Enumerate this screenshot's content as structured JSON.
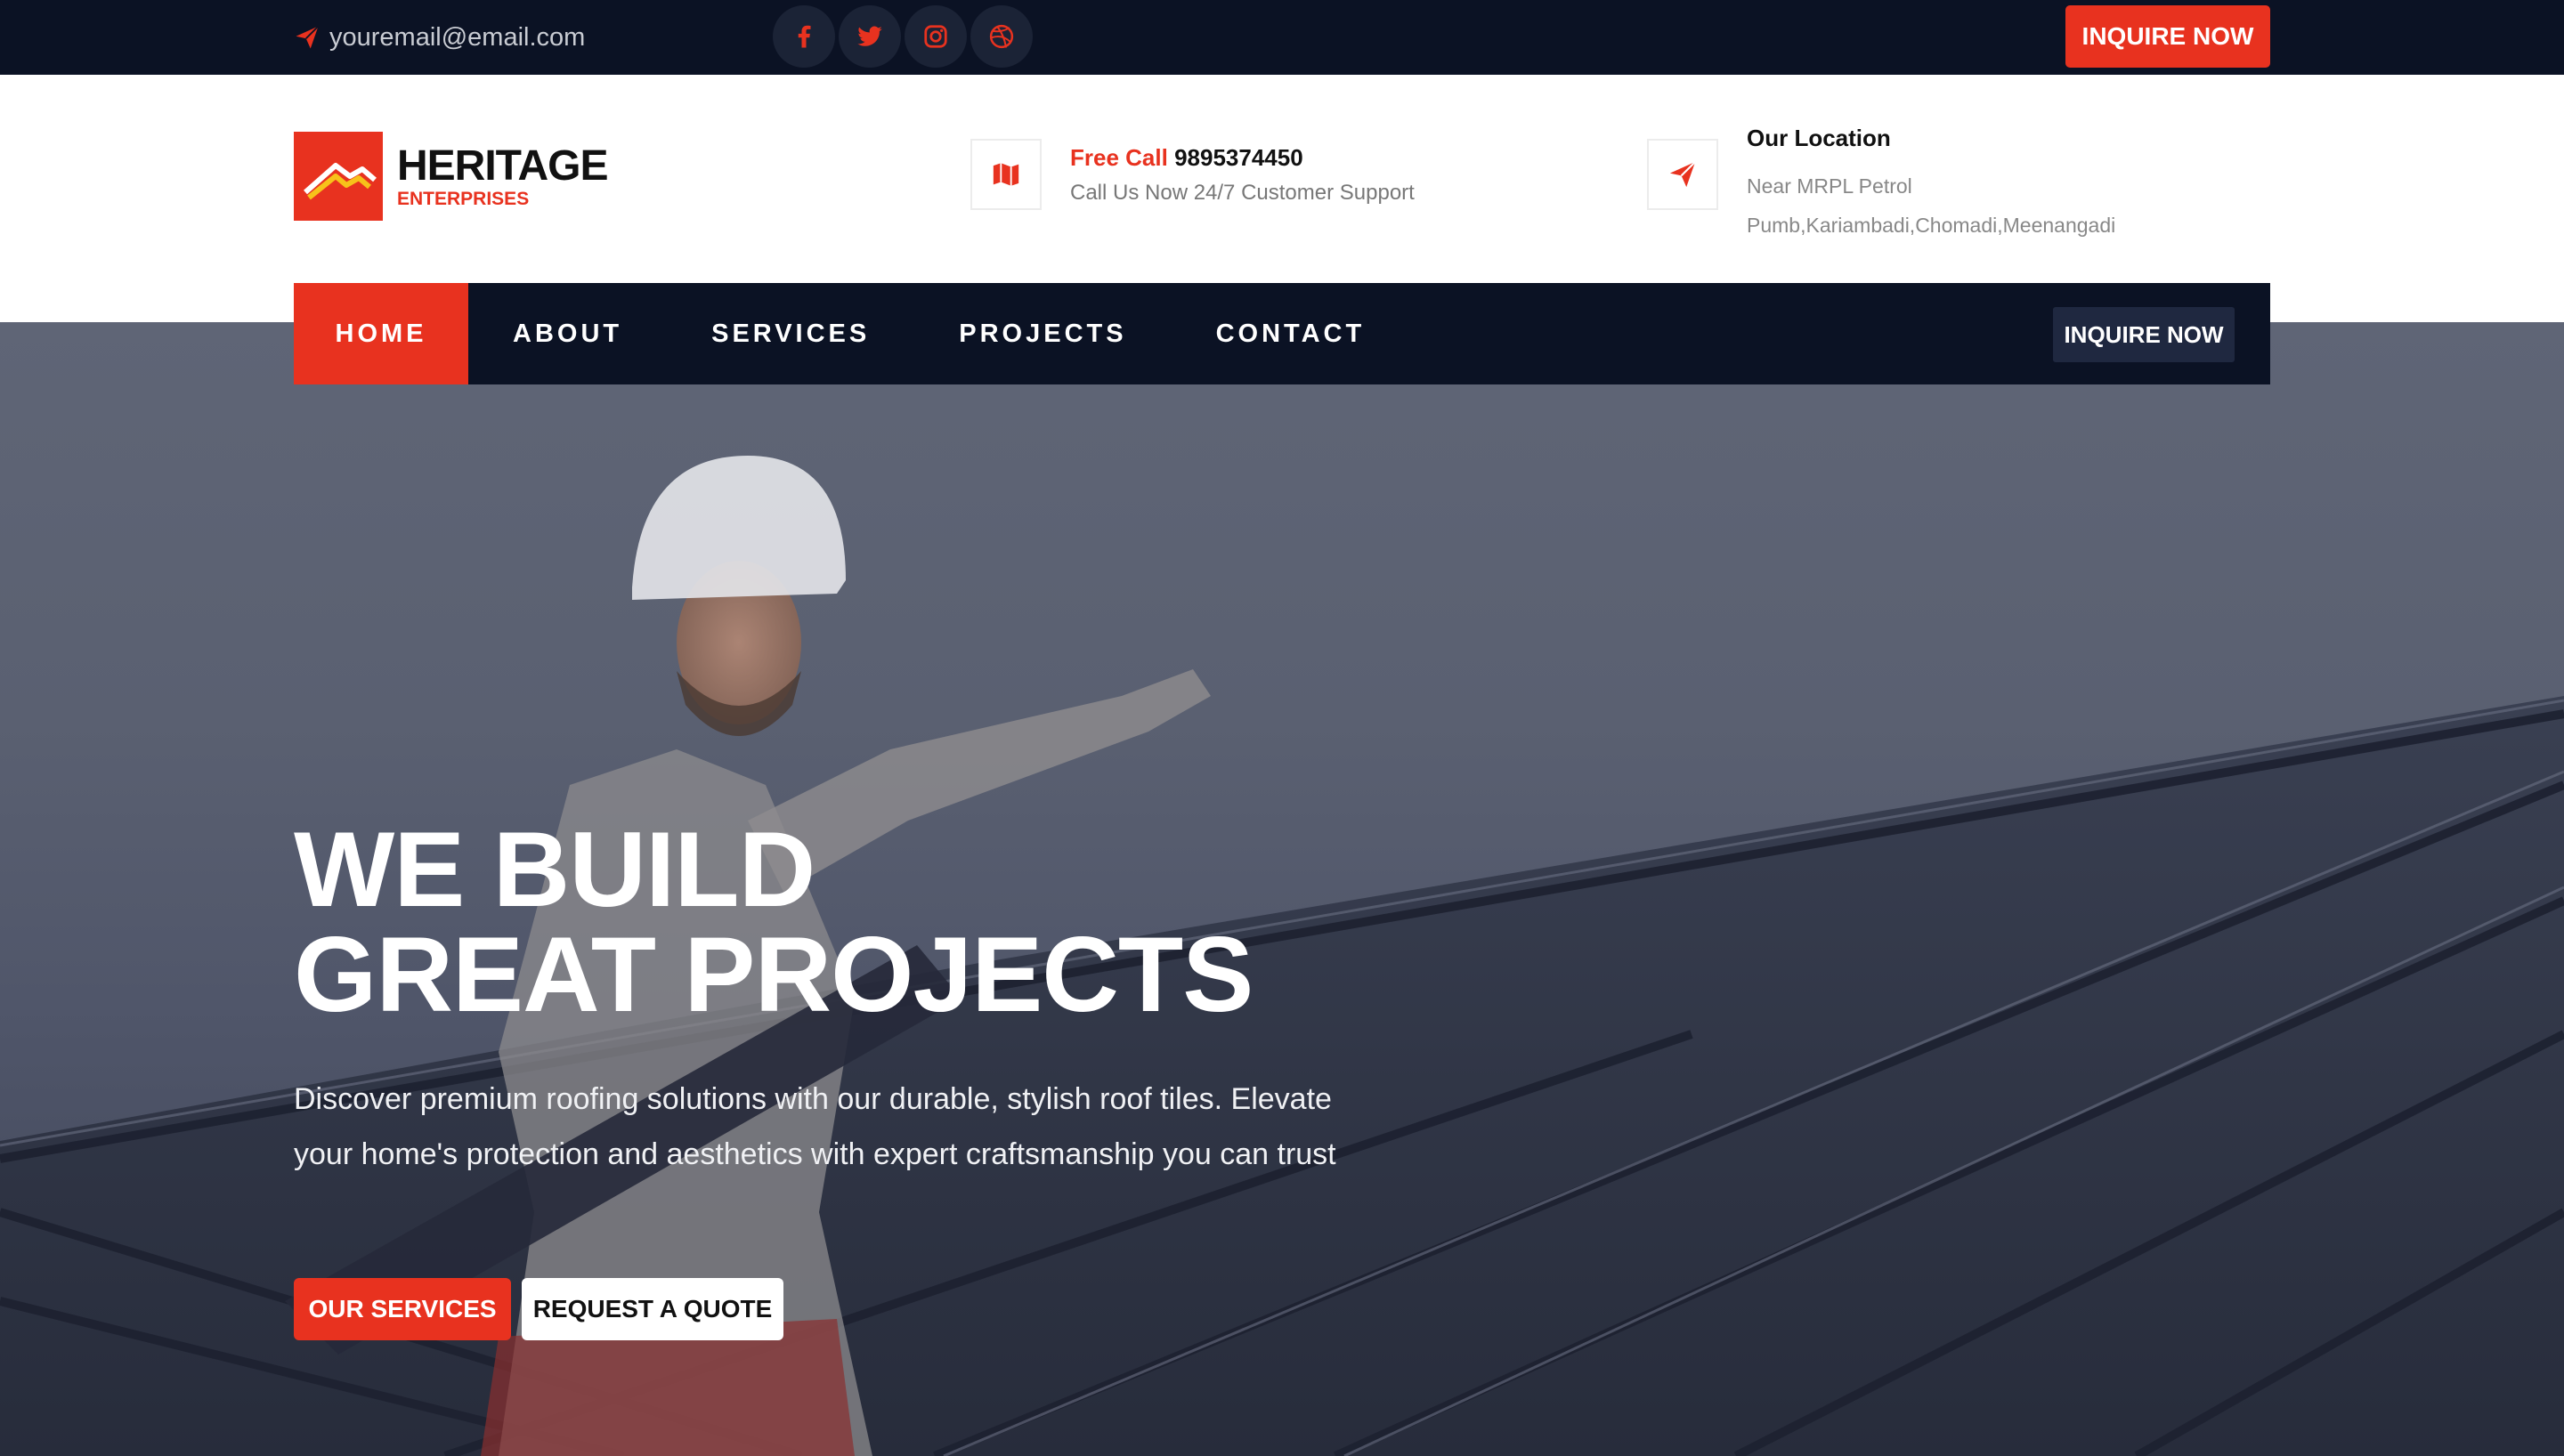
{
  "topbar": {
    "email": "youremail@email.com",
    "socials": [
      "facebook-icon",
      "twitter-icon",
      "instagram-icon",
      "dribbble-icon"
    ],
    "inquire_label": "INQUIRE NOW"
  },
  "brand": {
    "name": "HERITAGE",
    "subtitle": "ENTERPRISES"
  },
  "contact": {
    "call_prefix": "Free Call",
    "phone": "9895374450",
    "call_note": "Call Us Now 24/7 Customer Support",
    "location_title": "Our Location",
    "address_line1": "Near MRPL Petrol",
    "address_line2": "Pumb,Kariambadi,Chomadi,Meenangadi"
  },
  "nav": {
    "items": [
      {
        "label": "HOME",
        "active": true
      },
      {
        "label": "ABOUT",
        "active": false
      },
      {
        "label": "SERVICES",
        "active": false
      },
      {
        "label": "PROJECTS",
        "active": false
      },
      {
        "label": "CONTACT",
        "active": false
      }
    ],
    "inquire_label": "INQUIRE NOW"
  },
  "hero": {
    "title_line1": "WE BUILD",
    "title_line2": "GREAT PROJECTS",
    "description": "Discover premium roofing solutions with our durable, stylish roof tiles. Elevate your home's protection and aesthetics with expert craftsmanship you can trust",
    "primary_button": "OUR SERVICES",
    "secondary_button": "REQUEST A QUOTE"
  },
  "colors": {
    "accent": "#e8321f",
    "dark": "#0b1224"
  }
}
